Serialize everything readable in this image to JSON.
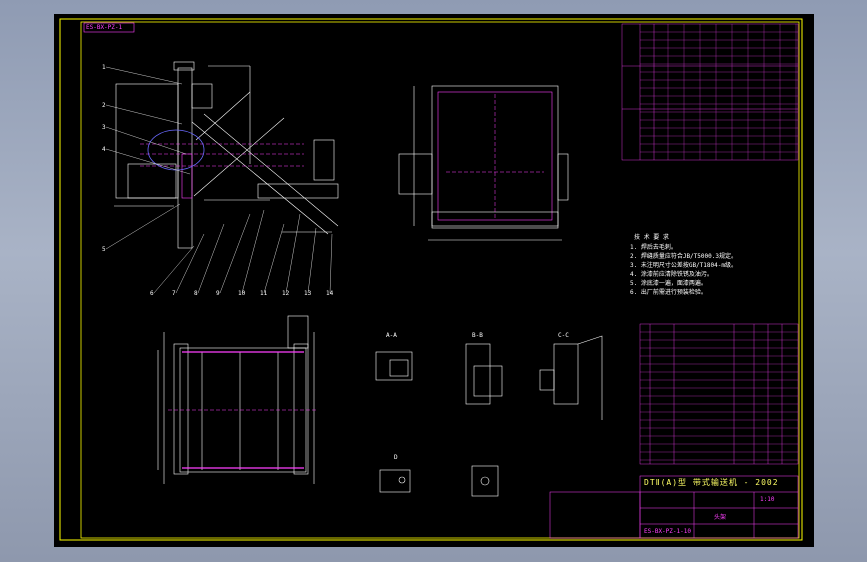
{
  "drawing": {
    "corner_code": "ES-BX-PZ-1",
    "title_block_title": "DTⅡ(A)型 带式输送机 - 2002",
    "drawing_number": "ES-BX-PZ-1-10",
    "part_name": "头架",
    "scale_text": "1:10",
    "notes_heading": "技 术 要 求",
    "note_lines": [
      "1. 焊后去毛刺。",
      "2. 焊缝质量应符合JB/T5000.3规定。",
      "3. 未注明尺寸公差按GB/T1804-m级。",
      "4. 涂漆前应清除铁锈及油污。",
      "5. 涂底漆一遍，面漆两遍。",
      "6. 出厂前需进行预装检验。"
    ],
    "leader_numbers": [
      "1",
      "2",
      "3",
      "4",
      "5",
      "6",
      "7",
      "8",
      "9",
      "10",
      "11",
      "12",
      "13",
      "14"
    ],
    "detail_labels": [
      "A-A",
      "B-B",
      "C-C",
      "D"
    ],
    "colors": {
      "background": "#000000",
      "border": "#ffff00",
      "geometry": "#ffffff",
      "annotation": "#ff40ff",
      "frame_ui": "#9aa4b8"
    }
  }
}
